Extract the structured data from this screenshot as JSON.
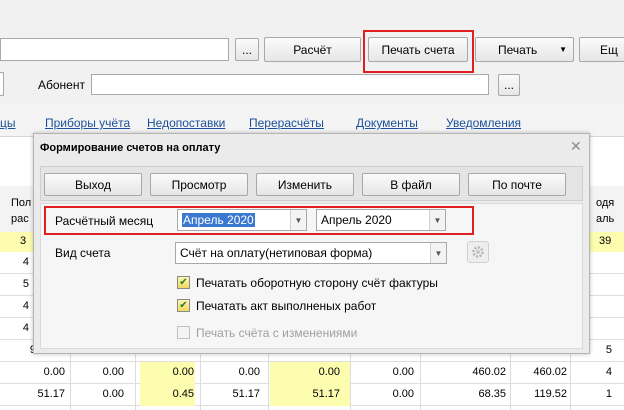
{
  "toolbar": {
    "ellipsis_label": "...",
    "calc_label": "Расчёт",
    "print_invoice_label": "Печать счета",
    "print_label": "Печать",
    "more_label": "Ещ",
    "subscriber_label": "Абонент",
    "subscriber_value": "",
    "subscriber_ellipsis": "..."
  },
  "tabs": [
    {
      "label": "цы"
    },
    {
      "label": "Приборы учёта"
    },
    {
      "label": "Недопоставки"
    },
    {
      "label": "Перерасчёты"
    },
    {
      "label": "Документы"
    },
    {
      "label": "Уведомления"
    }
  ],
  "grid": {
    "header_left_top": "Пол",
    "header_left_bottom": "рас",
    "header_right_top": "одя",
    "header_right_bottom": "аль",
    "yellow_left": "3",
    "yellow_right": "39",
    "rows": [
      {
        "c1": "4"
      },
      {
        "c1": "5"
      },
      {
        "c1": "4"
      },
      {
        "c1": "4"
      },
      {
        "c1": "9",
        "c2": "5"
      },
      {
        "c1": "0.00",
        "c2": "0.00",
        "c3": "0.00",
        "c4": "0.00",
        "c5": "0.00",
        "c6": "0.00",
        "c7": "460.02",
        "c8": "460.02",
        "c9": "4"
      },
      {
        "c1": "51.17",
        "c2": "0.00",
        "c3": "0.45",
        "c4": "51.17",
        "c5": "51.17",
        "c6": "0.00",
        "c7": "68.35",
        "c8": "119.52",
        "c9": "1"
      }
    ]
  },
  "dialog": {
    "title": "Формирование счетов на оплату",
    "close_glyph": "✕",
    "buttons": {
      "exit": "Выход",
      "preview": "Просмотр",
      "edit": "Изменить",
      "to_file": "В файл",
      "by_mail": "По почте"
    },
    "period_label": "Расчётный месяц",
    "period_from": "Апрель 2020",
    "period_to": "Апрель 2020",
    "invoice_type_label": "Вид счета",
    "invoice_type_value": "Счёт на оплату(нетиповая форма)",
    "checkboxes": [
      {
        "label": "Печатать оборотную сторону счёт фактуры",
        "checked": true,
        "enabled": true
      },
      {
        "label": "Печатать акт выполненых работ",
        "checked": true,
        "enabled": true
      },
      {
        "label": "Печать счёта с изменениями",
        "checked": false,
        "enabled": false
      }
    ]
  },
  "colors": {
    "highlight": "#e02020",
    "selection": "#3b79d0",
    "link": "#1b4f9b",
    "yellow_row": "#fdfdb0"
  },
  "icons": {
    "dropdown": "chevron-down-icon",
    "close": "close-icon",
    "gear": "gear-icon",
    "check": "checkmark-icon"
  }
}
